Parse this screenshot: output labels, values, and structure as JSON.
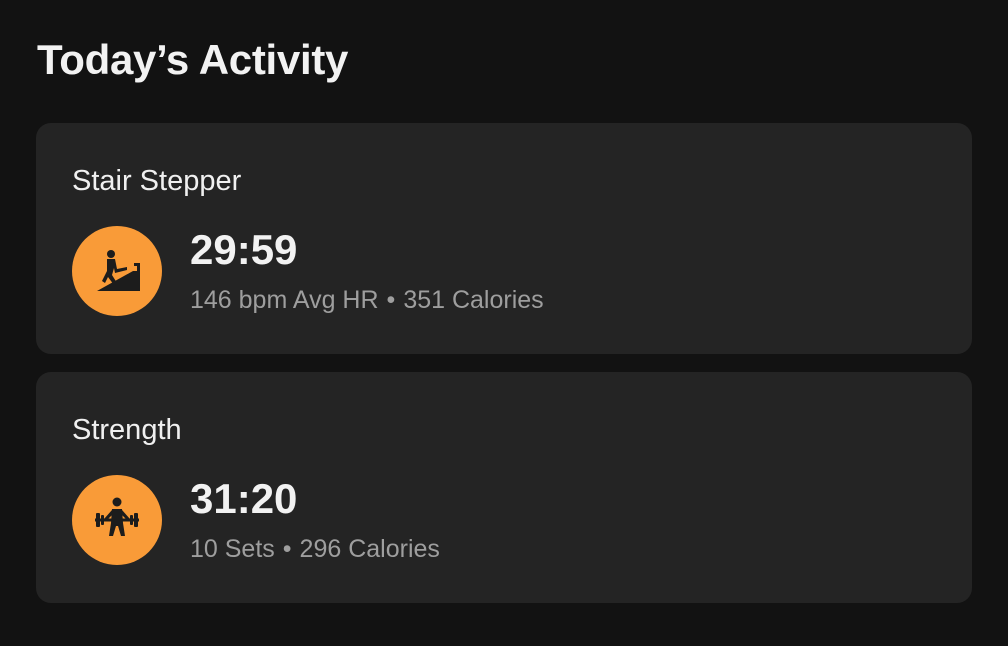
{
  "header": {
    "title": "Today’s Activity"
  },
  "activities": [
    {
      "name": "Stair Stepper",
      "icon": "stair-stepper-icon",
      "duration": "29:59",
      "stat1": "146 bpm Avg HR",
      "separator": "•",
      "stat2": "351 Calories"
    },
    {
      "name": "Strength",
      "icon": "weightlifting-icon",
      "duration": "31:20",
      "stat1": "10 Sets",
      "separator": "•",
      "stat2": "296 Calories"
    }
  ],
  "colors": {
    "background": "#121212",
    "card": "#242424",
    "accent": "#f99b38",
    "primary_text": "#f2f2f2",
    "secondary_text": "#9e9e9e"
  }
}
